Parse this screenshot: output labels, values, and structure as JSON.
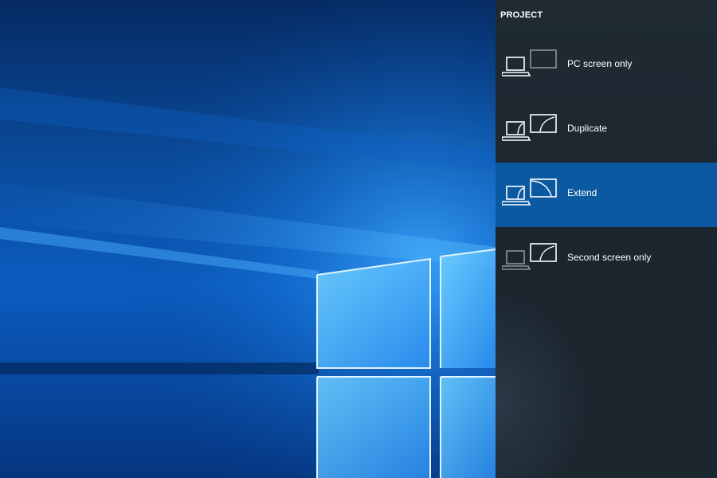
{
  "panel": {
    "title": "PROJECT",
    "options": [
      {
        "label": "PC screen only",
        "icon": "pc-screen-only-icon",
        "selected": false
      },
      {
        "label": "Duplicate",
        "icon": "duplicate-icon",
        "selected": false
      },
      {
        "label": "Extend",
        "icon": "extend-icon",
        "selected": true
      },
      {
        "label": "Second screen only",
        "icon": "second-screen-only-icon",
        "selected": false
      }
    ]
  },
  "colors": {
    "panel_background": "#1f2a33",
    "selected_background": "#0b5aa1",
    "text": "#ffffff",
    "wallpaper_blue": "#0a5bc4"
  }
}
